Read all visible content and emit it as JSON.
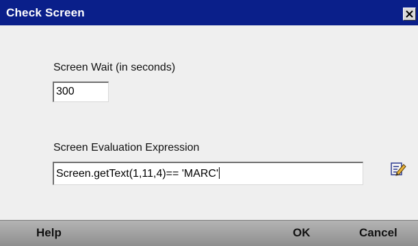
{
  "window": {
    "title": "Check Screen",
    "close_glyph": "✕"
  },
  "form": {
    "screen_wait_label": "Screen Wait (in seconds)",
    "screen_wait_value": "300",
    "eval_label": "Screen Evaluation Expression",
    "eval_value": "Screen.getText(1,11,4)== 'MARC'",
    "edit_icon": "edit-expression-icon"
  },
  "footer": {
    "help_label": "Help",
    "ok_label": "OK",
    "cancel_label": "Cancel"
  },
  "colors": {
    "titlebar": "#0a1f8a",
    "dialog_bg": "#efefef",
    "footer_bg": "#a3a3a3"
  }
}
